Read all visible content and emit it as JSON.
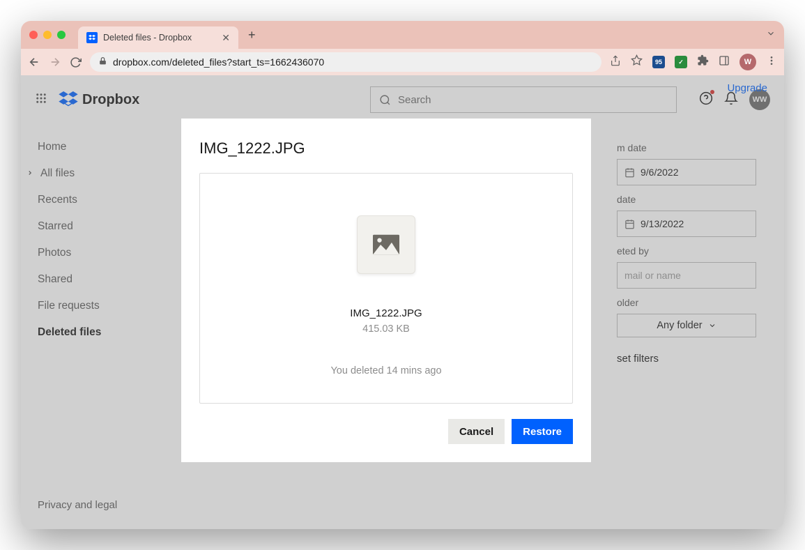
{
  "browser": {
    "tab_title": "Deleted files - Dropbox",
    "url": "dropbox.com/deleted_files?start_ts=1662436070",
    "avatar_initial": "W"
  },
  "header": {
    "brand": "Dropbox",
    "upgrade": "Upgrade",
    "search_placeholder": "Search",
    "avatar_initials": "WW"
  },
  "sidebar": {
    "items": [
      {
        "label": "Home"
      },
      {
        "label": "All files",
        "expandable": true
      },
      {
        "label": "Recents"
      },
      {
        "label": "Starred"
      },
      {
        "label": "Photos"
      },
      {
        "label": "Shared"
      },
      {
        "label": "File requests"
      },
      {
        "label": "Deleted files",
        "active": true
      }
    ],
    "footer": "Privacy and legal"
  },
  "filters": {
    "from_label": "m date",
    "from_value": "9/6/2022",
    "to_label": "date",
    "to_value": "9/13/2022",
    "deleted_by_label": "eted by",
    "deleted_by_placeholder": "mail or name",
    "folder_label": "older",
    "folder_value": "Any folder",
    "reset": "set filters"
  },
  "modal": {
    "title": "IMG_1222.JPG",
    "file_name": "IMG_1222.JPG",
    "file_size": "415.03 KB",
    "status": "You deleted 14 mins ago",
    "cancel": "Cancel",
    "restore": "Restore"
  }
}
